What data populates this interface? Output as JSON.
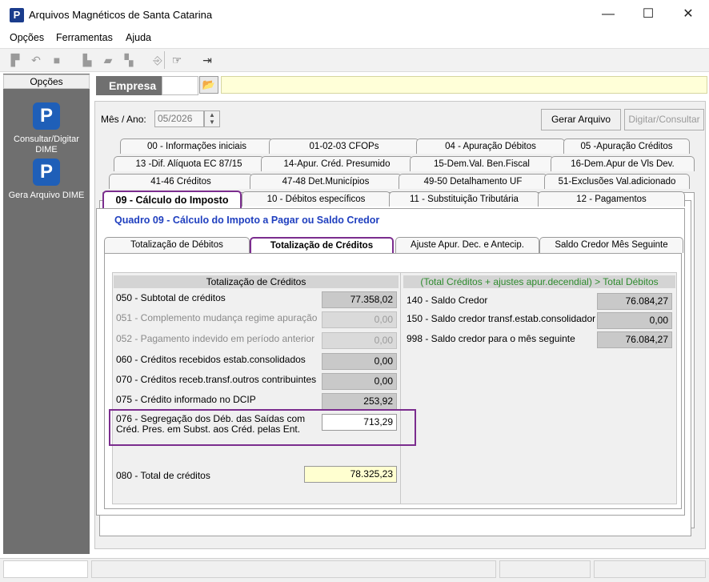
{
  "window": {
    "title": "Arquivos Magnéticos de Santa Catarina",
    "app_icon": "P",
    "minimize": "—",
    "maximize": "☐",
    "close": "✕"
  },
  "menu": [
    "Opções",
    "Ferramentas",
    "Ajuda"
  ],
  "sidebar": {
    "header": "Opções",
    "items": [
      {
        "label": "Consultar/Digitar DIME",
        "icon": "P"
      },
      {
        "label": "Gera Arquivo DIME",
        "icon": "P"
      }
    ]
  },
  "empresa": {
    "label": "Empresa",
    "code": "",
    "name": "",
    "browse_icon": "📂"
  },
  "period": {
    "label": "Mês / Ano:",
    "value": "05/2026"
  },
  "buttons": {
    "gerar": "Gerar Arquivo",
    "digitar": "Digitar/Consultar"
  },
  "tabs": {
    "row1": [
      "00 - Informações iniciais",
      "01-02-03  CFOPs",
      "04 - Apuração Débitos",
      "05 -Apuração Créditos"
    ],
    "row2": [
      "13 -Dif. Alíquota EC 87/15",
      "14-Apur. Créd. Presumido",
      "15-Dem.Val. Ben.Fiscal",
      "16-Dem.Apur de Vls Dev."
    ],
    "row3": [
      "41-46   Créditos",
      "47-48  Det.Municípios",
      "49-50  Detalhamento UF",
      "51-Exclusões Val.adicionado"
    ],
    "row4": [
      "09 - Cálculo do Imposto",
      "10 - Débitos específicos",
      "11 - Substituição Tributária",
      "12 - Pagamentos"
    ]
  },
  "quadro_title": "Quadro 09 - Cálculo do Impoto a Pagar ou Saldo Credor",
  "subtabs": [
    "Totalização de Débitos",
    "Totalização de Créditos",
    "Ajuste Apur. Dec. e Antecip.",
    "Saldo Credor Mês Seguinte"
  ],
  "left_section": {
    "header": "Totalização de Créditos",
    "rows": [
      {
        "label": "050 - Subtotal de créditos",
        "value": "77.358,02"
      },
      {
        "label": "051 - Complemento mudança regime apuração",
        "value": "0,00"
      },
      {
        "label": "052 - Pagamento indevido em período anterior",
        "value": "0,00"
      },
      {
        "label": "060 - Créditos recebidos estab.consolidados",
        "value": "0,00"
      },
      {
        "label": "070 - Créditos receb.transf.outros contribuintes",
        "value": "0,00"
      },
      {
        "label": "075 - Crédito informado no DCIP",
        "value": "253,92"
      }
    ],
    "row076": {
      "line1": "076 - Segregação dos Déb. das Saídas com",
      "line2": "Créd. Pres. em Subst. aos Créd. pelas Ent.",
      "value": "713,29"
    },
    "row080": {
      "label": "080 - Total de créditos",
      "value": "78.325,23"
    }
  },
  "right_section": {
    "header": "(Total Créditos + ajustes apur.decendial) > Total Débitos",
    "rows": [
      {
        "label": "140 - Saldo Credor",
        "value": "76.084,27"
      },
      {
        "label": "150 - Saldo credor transf.estab.consolidador",
        "value": "0,00"
      },
      {
        "label": "998 - Saldo credor para o mês seguinte",
        "value": "76.084,27"
      }
    ]
  },
  "colors": {
    "highlight": "#7b2d8e",
    "quadro_title": "#1f3fbf",
    "right_header": "#2e8b2e",
    "brand": "#1a3c8c"
  }
}
